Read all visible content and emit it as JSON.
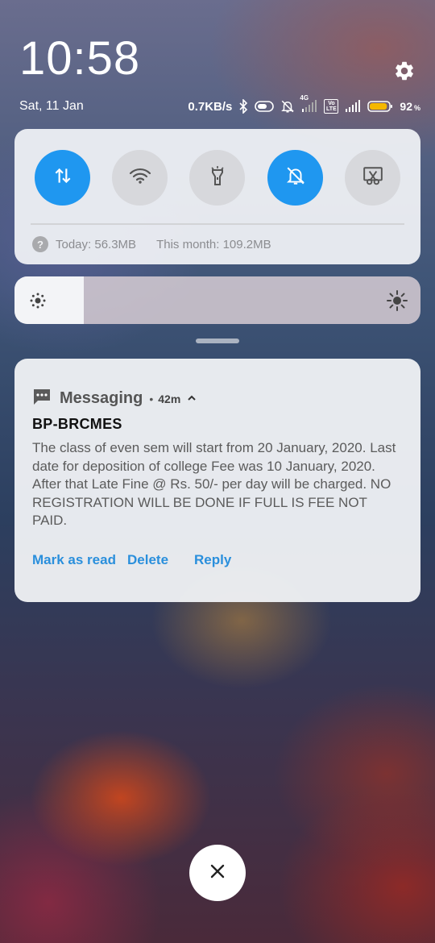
{
  "status_bar": {
    "time": "10:58",
    "date": "Sat, 11 Jan",
    "net_speed": "0.7KB/s",
    "network_type": "4G",
    "volte": "Vo LTE",
    "battery_percent": "92",
    "battery_unit": "%",
    "battery_level": 0.92,
    "icons": [
      "bluetooth-icon",
      "toggle-icon",
      "silent-bell-icon",
      "signal-icon",
      "volte-icon",
      "signal-icon",
      "battery-icon"
    ]
  },
  "quick_settings": {
    "toggles": [
      {
        "name": "mobile-data",
        "icon": "data-arrows-icon",
        "active": true
      },
      {
        "name": "wifi",
        "icon": "wifi-icon",
        "active": false
      },
      {
        "name": "flashlight",
        "icon": "flashlight-icon",
        "active": false
      },
      {
        "name": "silent",
        "icon": "silent-bell-icon",
        "active": true
      },
      {
        "name": "screenshot",
        "icon": "scissors-icon",
        "active": false
      }
    ],
    "data_usage_today": "Today: 56.3MB",
    "data_usage_month": "This month: 109.2MB",
    "help_icon_glyph": "?"
  },
  "brightness": {
    "level": 0.17
  },
  "notification": {
    "app_name": "Messaging",
    "dot": "•",
    "time": "42m",
    "sender": "BP-BRCMES",
    "body": "The class of even sem will start from 20 January, 2020. Last date for deposition of college Fee was 10 January, 2020. After that Late Fine @ Rs. 50/- per day will be charged. NO REGISTRATION WILL BE DONE IF FULL IS FEE NOT PAID.",
    "actions": {
      "mark_read": "Mark as read",
      "delete": "Delete",
      "reply": "Reply"
    }
  },
  "colors": {
    "accent": "#1f97f0",
    "action_text": "#2a8fdc",
    "battery": "#f5b800"
  }
}
